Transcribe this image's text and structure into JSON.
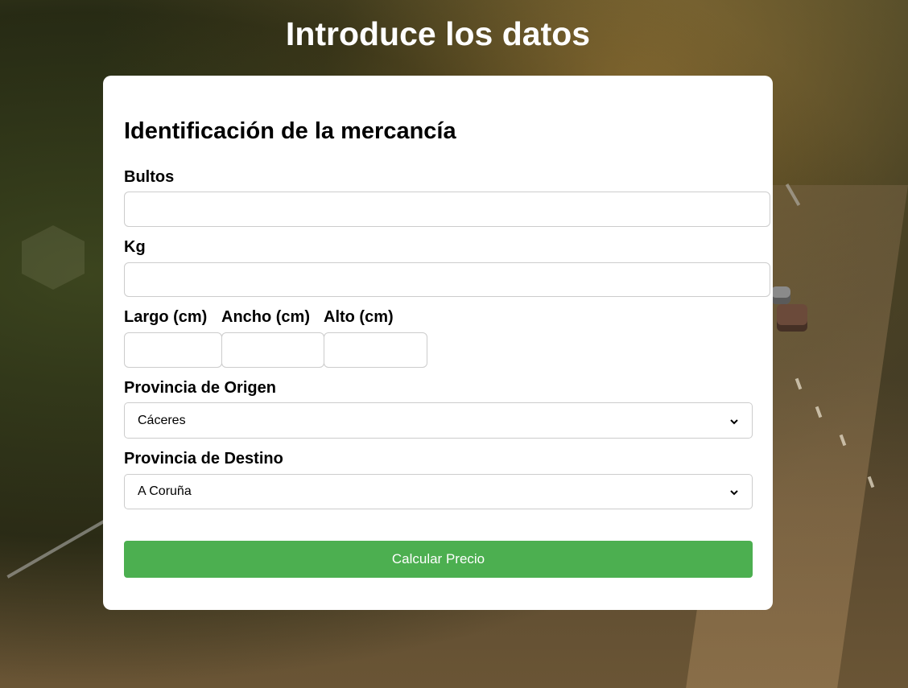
{
  "page": {
    "title": "Introduce los datos"
  },
  "form": {
    "section_title": "Identificación de la mercancía",
    "fields": {
      "bultos": {
        "label": "Bultos",
        "value": ""
      },
      "kg": {
        "label": "Kg",
        "value": ""
      },
      "largo": {
        "label": "Largo (cm)",
        "value": ""
      },
      "ancho": {
        "label": "Ancho (cm)",
        "value": ""
      },
      "alto": {
        "label": "Alto (cm)",
        "value": ""
      }
    },
    "origen": {
      "label": "Provincia de Origen",
      "selected": "Cáceres"
    },
    "destino": {
      "label": "Provincia de Destino",
      "selected": "A Coruña"
    },
    "submit_label": "Calcular Precio"
  },
  "colors": {
    "button": "#4caf50",
    "card": "#ffffff",
    "title_text": "#ffffff"
  },
  "icons": {
    "select_arrow": "chevron-down-icon"
  }
}
